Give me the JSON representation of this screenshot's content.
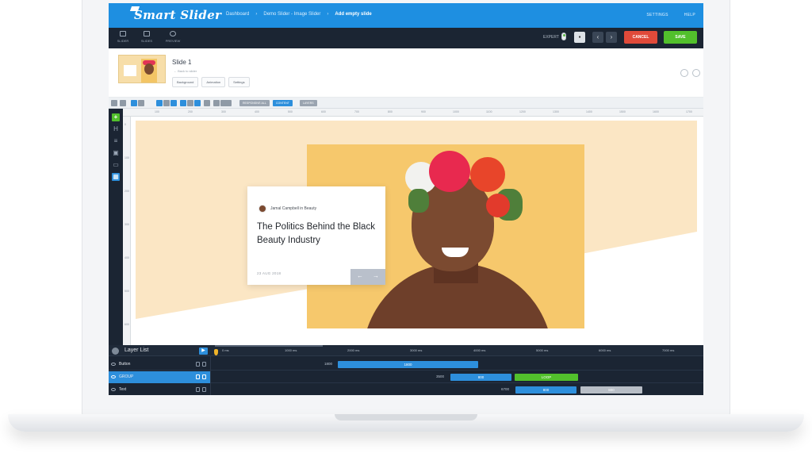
{
  "app": {
    "logo": "Smart Slider"
  },
  "breadcrumb": [
    "Dashboard",
    "Demo Slider - Image Slider",
    "Add empty slide"
  ],
  "top_links": [
    "SETTINGS",
    "HELP"
  ],
  "toolbar": {
    "tabs": [
      "SLIDER",
      "SLIDES",
      "PREVIEW"
    ],
    "expert_label": "EXPERT",
    "cancel_label": "CANCEL",
    "save_label": "SAVE"
  },
  "slide": {
    "title": "Slide 1",
    "back_label": "← Back to slider",
    "tabs": [
      "Background",
      "Animation",
      "Settings"
    ]
  },
  "editor_toolbar": {
    "pills": [
      "RESPONSIVE ALL",
      "CONTENT",
      "LAYERS"
    ]
  },
  "ruler": {
    "top": [
      "100",
      "200",
      "300",
      "400",
      "500",
      "600",
      "700",
      "800",
      "900",
      "1000",
      "1100",
      "1200",
      "1300",
      "1400",
      "1500",
      "1600",
      "1700"
    ],
    "left": [
      "0",
      "100",
      "200",
      "300",
      "400",
      "500",
      "600"
    ]
  },
  "card": {
    "author": "Jamal Campbell in Beauty",
    "title": "The Politics Behind the Black Beauty Industry",
    "date": "23 AUG 2018",
    "prev": "←",
    "next": "→"
  },
  "timeline": {
    "title": "Layer List",
    "ticks": [
      "0 ms",
      "1000 ms",
      "2000 ms",
      "3000 ms",
      "4000 ms",
      "5000 ms",
      "6000 ms",
      "7000 ms"
    ],
    "rows": [
      {
        "name": "Button",
        "value": "1800",
        "bars": [
          {
            "label": "1800",
            "kind": "blue"
          }
        ]
      },
      {
        "name": "GROUP",
        "value": "3500",
        "bars": [
          {
            "label": "800",
            "kind": "blue"
          },
          {
            "label": "LOOP",
            "kind": "green"
          }
        ]
      },
      {
        "name": "Text",
        "value": "6700",
        "bars": [
          {
            "label": "800",
            "kind": "blue"
          },
          {
            "label": "800",
            "kind": "grey"
          }
        ]
      }
    ]
  },
  "colors": {
    "brand_blue": "#1e8fe1",
    "dark": "#1b2533",
    "cancel": "#e04a3a",
    "save": "#52c02c",
    "canvas_bg": "#fbe6c4"
  }
}
